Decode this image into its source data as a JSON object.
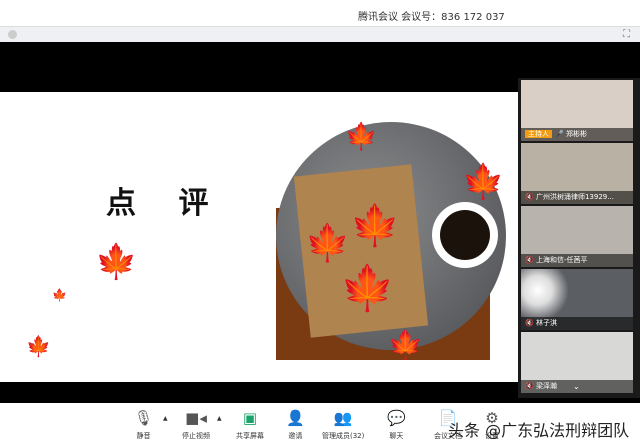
{
  "window": {
    "title": "腾讯会议 会议号：836 172 037"
  },
  "slide": {
    "title": "点 评"
  },
  "participants": [
    {
      "name": "郑彬彬",
      "host_label": "主持人",
      "bg": "#d9cfc6"
    },
    {
      "name": "广州洪树涌律师13929...",
      "bg": "#b9b2a4"
    },
    {
      "name": "上海和信-任茜平",
      "bg": "#b8b3ad"
    },
    {
      "name": "林子淇",
      "bg": "#5b5e63"
    },
    {
      "name": "梁泽瀚",
      "bg": "#d8d8d6"
    }
  ],
  "toolbar": {
    "items": [
      {
        "label": "静音",
        "icon": "microphone-icon"
      },
      {
        "label": "停止视频",
        "icon": "video-camera-icon"
      },
      {
        "label": "共享屏幕",
        "icon": "share-screen-icon"
      },
      {
        "label": "邀请",
        "icon": "invite-icon"
      },
      {
        "label": "管理成员(32)",
        "icon": "members-icon"
      },
      {
        "label": "聊天",
        "icon": "chat-icon"
      },
      {
        "label": "会议文档",
        "icon": "document-icon"
      },
      {
        "label": "设置",
        "icon": "settings-icon"
      }
    ]
  },
  "watermark": "头条 @广东弘法刑辩团队"
}
